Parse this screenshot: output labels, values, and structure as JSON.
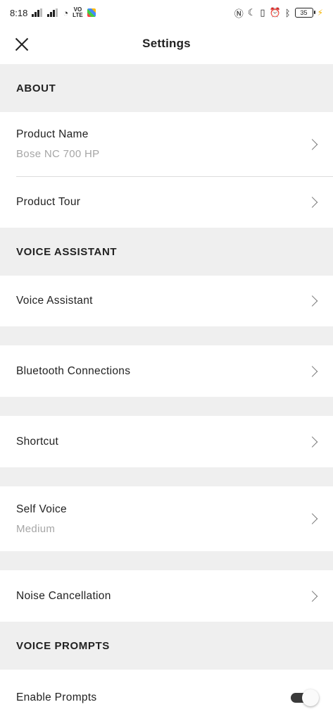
{
  "status_bar": {
    "time": "8:18",
    "volte": "VO\nLTE",
    "battery": "35"
  },
  "header": {
    "title": "Settings"
  },
  "sections": {
    "about": "ABOUT",
    "voice_assistant": "VOICE ASSISTANT",
    "voice_prompts": "VOICE PROMPTS"
  },
  "rows": {
    "product_name": {
      "label": "Product Name",
      "value": "Bose NC 700 HP"
    },
    "product_tour": {
      "label": "Product Tour"
    },
    "voice_assistant": {
      "label": "Voice Assistant"
    },
    "bluetooth": {
      "label": "Bluetooth Connections"
    },
    "shortcut": {
      "label": "Shortcut"
    },
    "self_voice": {
      "label": "Self Voice",
      "value": "Medium"
    },
    "noise_cancellation": {
      "label": "Noise Cancellation"
    },
    "enable_prompts": {
      "label": "Enable Prompts",
      "enabled": true
    }
  }
}
